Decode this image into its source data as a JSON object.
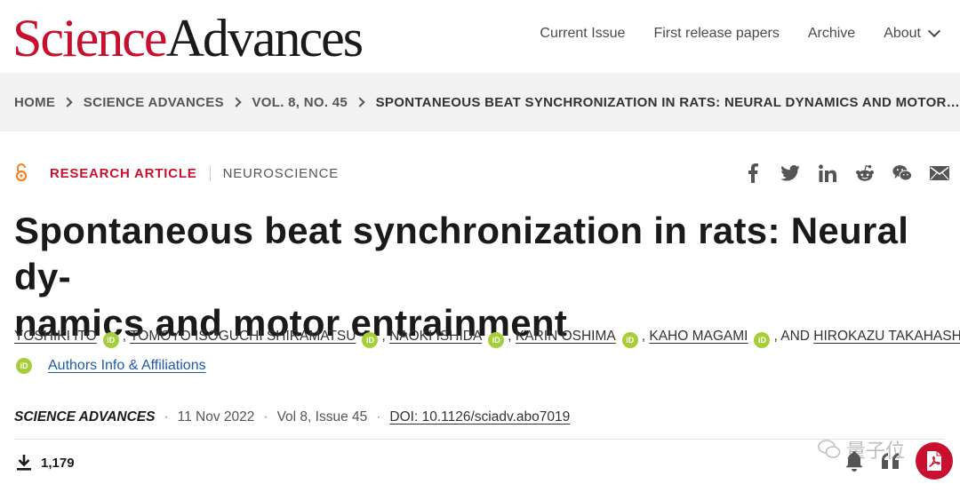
{
  "header": {
    "logo_part1": "Science",
    "logo_part2": "Advances",
    "nav": [
      "Current Issue",
      "First release papers",
      "Archive",
      "About"
    ]
  },
  "breadcrumb": {
    "items": [
      "HOME",
      "SCIENCE ADVANCES",
      "VOL. 8, NO. 45"
    ],
    "current": "SPONTANEOUS BEAT SYNCHRONIZATION IN RATS: NEURAL DYNAMICS AND MOTOR…"
  },
  "article": {
    "type": "RESEARCH ARTICLE",
    "subject": "NEUROSCIENCE",
    "title": "Spontaneous beat synchronization in rats: Neural dy-namics and motor entrainment",
    "title_line1": "Spontaneous beat synchronization in rats: Neural dy-",
    "title_line2": "namics and motor entrainment",
    "authors": [
      "YOSHIKI ITO",
      "TOMOYO ISOGUCHI SHIRAMATSU",
      "NAOKI ISHIDA",
      "KARIN OSHIMA",
      "KAHO MAGAMI",
      "HIROKAZU TAKAHASHI"
    ],
    "and_label": "AND",
    "orcid_label": "iD",
    "affiliations_link": "Authors Info & Affiliations",
    "journal": "SCIENCE ADVANCES",
    "date": "11 Nov 2022",
    "volume": "Vol 8, Issue 45",
    "doi": "DOI: 10.1126/sciadv.abo7019",
    "downloads": "1,179"
  },
  "share_icons": [
    "facebook-icon",
    "twitter-icon",
    "linkedin-icon",
    "reddit-icon",
    "wechat-icon",
    "email-icon"
  ],
  "watermark": "量子位",
  "colors": {
    "brand_red": "#c8102e",
    "orcid_green": "#a6ce39",
    "link_blue": "#1f5aa6",
    "breadcrumb_bg": "#f2f2f2"
  }
}
